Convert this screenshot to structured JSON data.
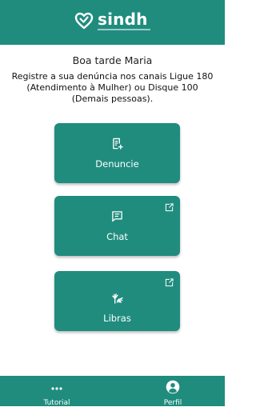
{
  "app": {
    "logo_text": "sindh",
    "greeting": "Boa tarde Maria",
    "instruction": "Registre a sua denúncia nos canais Ligue 180 (Atendimento à Mulher) ou Disque 100 (Demais pessoas)."
  },
  "cards": [
    {
      "label": "Denuncie",
      "icon": "report-icon",
      "external": false
    },
    {
      "label": "Chat",
      "icon": "chat-icon",
      "external": true
    },
    {
      "label": "Libras",
      "icon": "sign-language-icon",
      "external": true
    }
  ],
  "bottom_nav": {
    "tutorial_label": "Tutorial",
    "tutorial_icon": "more-dots-icon",
    "profile_label": "Perfil",
    "profile_icon": "user-profile-icon"
  },
  "colors": {
    "primary": "#1f8c7e",
    "text_on_primary": "#ffffff"
  }
}
